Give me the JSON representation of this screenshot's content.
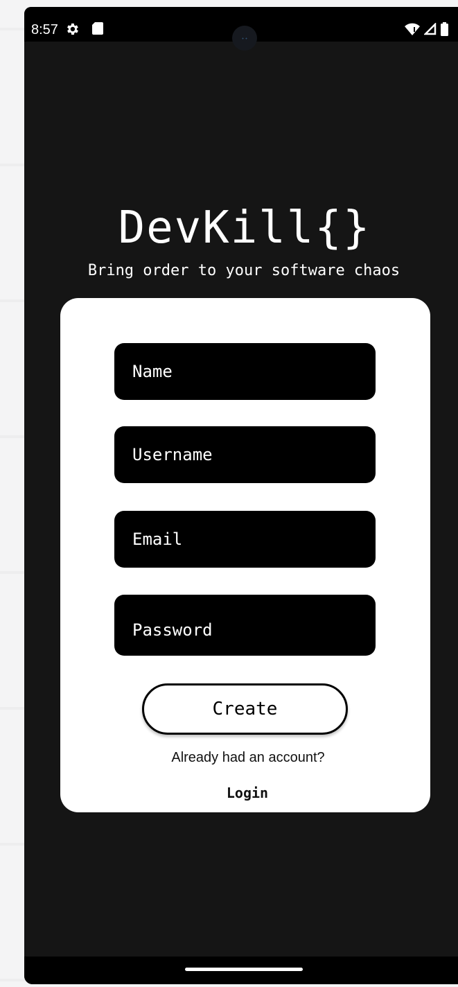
{
  "status_bar": {
    "time": "8:57",
    "icons": [
      "gear-icon",
      "sd-card-icon",
      "wifi-icon",
      "signal-icon",
      "battery-icon"
    ]
  },
  "brand": {
    "title": "DevKill{}",
    "tagline": "Bring order to your software chaos"
  },
  "form": {
    "name_placeholder": "Name",
    "username_placeholder": "Username",
    "email_placeholder": "Email",
    "password_placeholder": "Password",
    "create_label": "Create",
    "already_text": "Already had an account?",
    "login_label": "Login"
  },
  "colors": {
    "background": "#151515",
    "card": "#ffffff",
    "field": "#000000",
    "text_on_dark": "#ffffff"
  }
}
